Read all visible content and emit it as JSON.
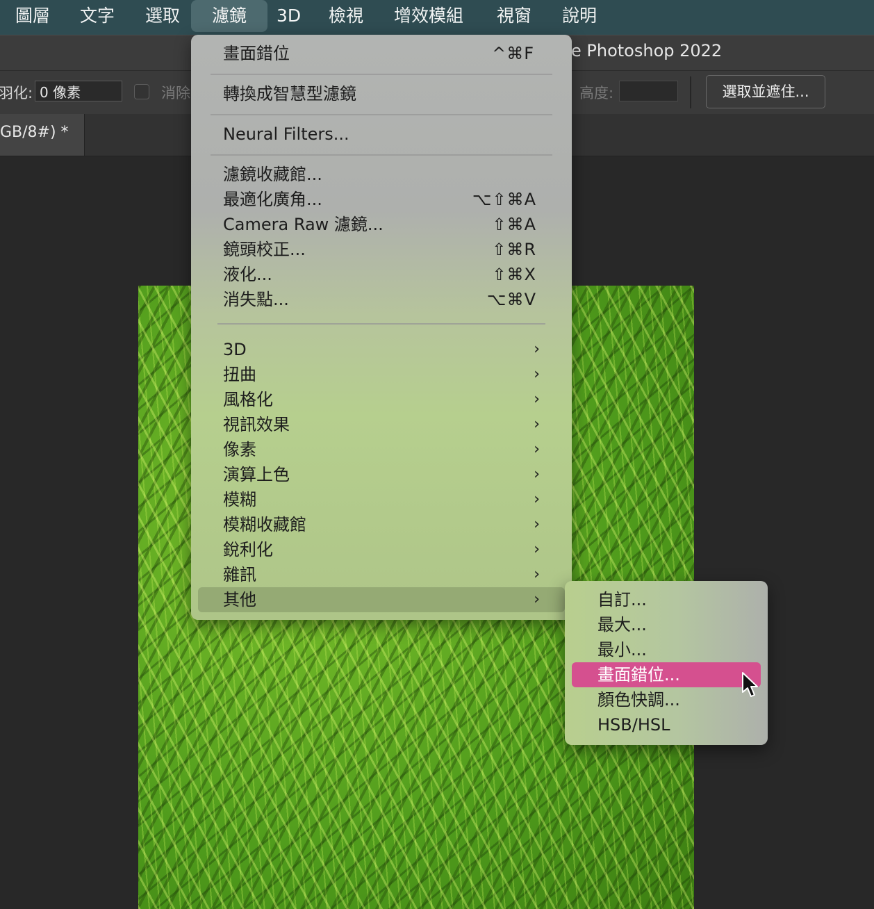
{
  "menubar": {
    "items": [
      "圖層",
      "文字",
      "選取",
      "濾鏡",
      "3D",
      "檢視",
      "增效模組",
      "視窗",
      "說明"
    ],
    "active_index": 3
  },
  "window": {
    "title": "e Photoshop 2022"
  },
  "options": {
    "feather_label": "羽化:",
    "feather_value": "0 像素",
    "antialias_label": "消除",
    "height_label": "高度:",
    "height_value": "",
    "select_mask_button": "選取並遮住..."
  },
  "document": {
    "tab_label": "GB/8#) *"
  },
  "filter_menu": {
    "last_filter": {
      "label": "畫面錯位",
      "shortcut": "^⌘F"
    },
    "convert_smart": {
      "label": "轉換成智慧型濾鏡"
    },
    "neural": {
      "label": "Neural Filters..."
    },
    "tools": [
      {
        "label": "濾鏡收藏館...",
        "shortcut": ""
      },
      {
        "label": "最適化廣角...",
        "shortcut": "⌥⇧⌘A"
      },
      {
        "label": "Camera Raw 濾鏡...",
        "shortcut": "⇧⌘A"
      },
      {
        "label": "鏡頭校正...",
        "shortcut": "⇧⌘R"
      },
      {
        "label": "液化...",
        "shortcut": "⇧⌘X"
      },
      {
        "label": "消失點...",
        "shortcut": "⌥⌘V"
      }
    ],
    "submenus": [
      "3D",
      "扭曲",
      "風格化",
      "視訊效果",
      "像素",
      "演算上色",
      "模糊",
      "模糊收藏館",
      "銳利化",
      "雜訊",
      "其他"
    ],
    "hovered_submenu": "其他",
    "chevron": "›"
  },
  "other_submenu": {
    "items": [
      "自訂...",
      "最大...",
      "最小...",
      "畫面錯位...",
      "顏色快調...",
      "HSB/HSL"
    ],
    "selected": "畫面錯位..."
  }
}
